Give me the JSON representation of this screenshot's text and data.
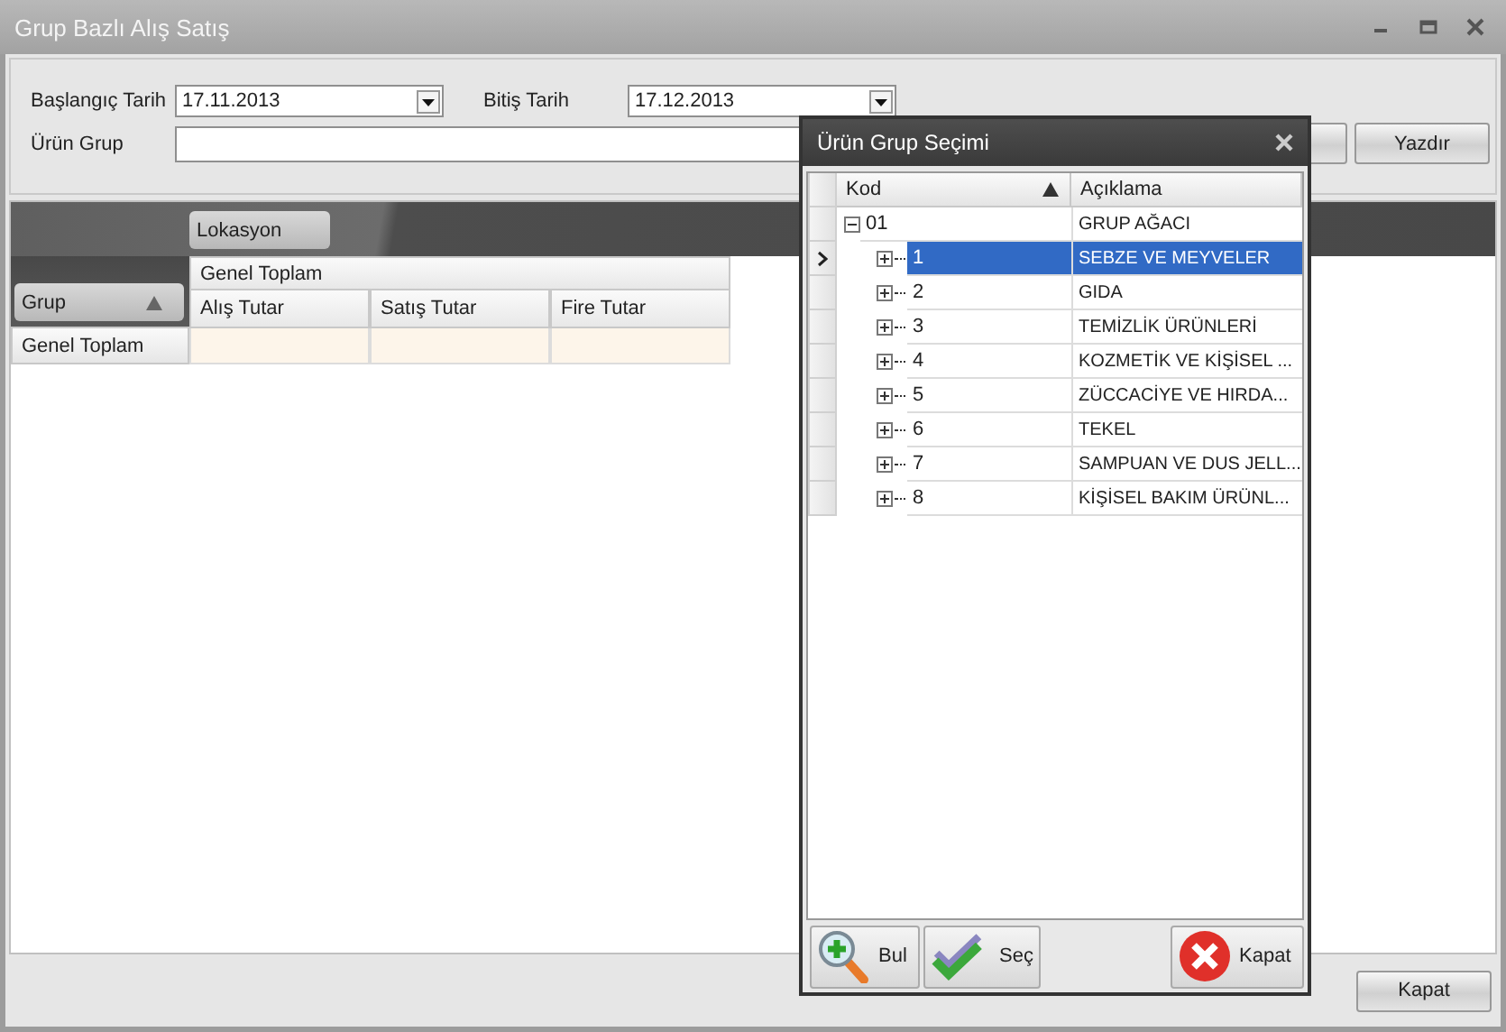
{
  "window": {
    "title": "Grup Bazlı Alış Satış"
  },
  "filters": {
    "start_label": "Başlangıç Tarih",
    "start_value": "17.11.2013",
    "end_label": "Bitiş Tarih",
    "end_value": "17.12.2013",
    "group_label": "Ürün Grup",
    "print_button": "Yazdır"
  },
  "pivot": {
    "column_field": "Lokasyon",
    "row_field": "Grup",
    "column_total": "Genel Toplam",
    "measures": [
      "Alış Tutar",
      "Satış Tutar",
      "Fire Tutar"
    ],
    "row_total": "Genel Toplam"
  },
  "footer": {
    "close_button": "Kapat"
  },
  "dialog": {
    "title": "Ürün Grup Seçimi",
    "columns": [
      {
        "label": "Kod",
        "sorted": true
      },
      {
        "label": "Açıklama",
        "sorted": false
      }
    ],
    "tree": [
      {
        "code": "01",
        "description": "GRUP AĞACI",
        "expanded": true,
        "selected": false,
        "children": [
          {
            "code": "1",
            "description": "SEBZE VE MEYVELER",
            "expanded": false,
            "selected": true
          },
          {
            "code": "2",
            "description": "GIDA",
            "expanded": false,
            "selected": false
          },
          {
            "code": "3",
            "description": "TEMİZLİK ÜRÜNLERİ",
            "expanded": false,
            "selected": false
          },
          {
            "code": "4",
            "description": "KOZMETİK VE KİŞİSEL ...",
            "expanded": false,
            "selected": false
          },
          {
            "code": "5",
            "description": "ZÜCCACİYE VE HIRDA...",
            "expanded": false,
            "selected": false
          },
          {
            "code": "6",
            "description": "TEKEL",
            "expanded": false,
            "selected": false
          },
          {
            "code": "7",
            "description": "SAMPUAN VE DUS JELL...",
            "expanded": false,
            "selected": false
          },
          {
            "code": "8",
            "description": "KİŞİSEL BAKIM ÜRÜNL...",
            "expanded": false,
            "selected": false
          }
        ]
      }
    ],
    "buttons": [
      {
        "kind": "find",
        "label": "Bul"
      },
      {
        "kind": "select",
        "label": "Seç"
      },
      {
        "kind": "close",
        "label": "Kapat"
      }
    ]
  }
}
